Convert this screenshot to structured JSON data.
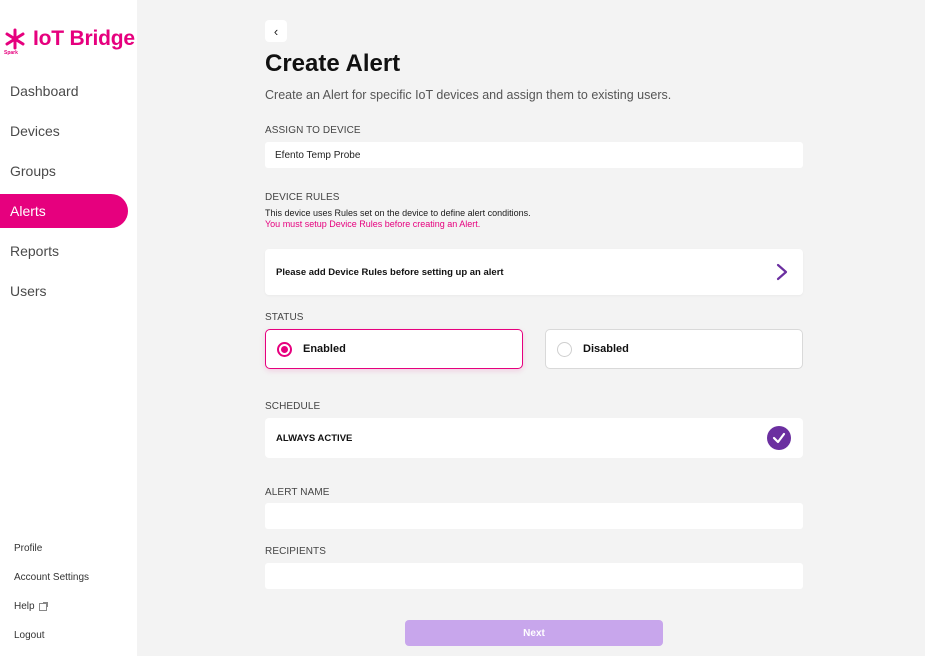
{
  "app": {
    "brand_name": "IoT Bridge",
    "brand_sub": "Spark",
    "brand_color": "#e6007e",
    "logo_icon": "asterisk-logo-icon"
  },
  "sidebar": {
    "items": [
      {
        "label": "Dashboard",
        "active": false
      },
      {
        "label": "Devices",
        "active": false
      },
      {
        "label": "Groups",
        "active": false
      },
      {
        "label": "Alerts",
        "active": true
      },
      {
        "label": "Reports",
        "active": false
      },
      {
        "label": "Users",
        "active": false
      }
    ],
    "bottom_items": [
      {
        "label": "Profile"
      },
      {
        "label": "Account Settings"
      },
      {
        "label": "Help",
        "icon": "external-link-icon"
      },
      {
        "label": "Logout"
      }
    ]
  },
  "header": {
    "back_icon": "chevron-left-icon",
    "back_glyph": "‹",
    "title": "Create Alert",
    "subtitle": "Create an Alert for specific IoT devices and assign them to existing users."
  },
  "form": {
    "device": {
      "label": "ASSIGN TO DEVICE",
      "value": "Efento Temp Probe"
    },
    "rules": {
      "label": "DEVICE RULES",
      "description": "This device uses Rules set on the device to define alert conditions.",
      "warning": "You must setup Device Rules before creating an Alert.",
      "card_text": "Please add Device Rules before setting up an alert",
      "arrow_icon": "chevron-right-icon",
      "arrow_color": "#6b2fa0"
    },
    "status": {
      "label": "STATUS",
      "options": [
        {
          "label": "Enabled",
          "selected": true
        },
        {
          "label": "Disabled",
          "selected": false
        }
      ]
    },
    "schedule": {
      "label": "SCHEDULE",
      "value": "ALWAYS ACTIVE",
      "check_icon": "check-circle-icon",
      "check_color": "#6b2fa0"
    },
    "alert_name": {
      "label": "ALERT NAME",
      "value": "",
      "placeholder": ""
    },
    "recipients": {
      "label": "RECIPIENTS",
      "value": "",
      "placeholder": ""
    },
    "next_label": "Next",
    "next_color": "#c8a6ec"
  }
}
